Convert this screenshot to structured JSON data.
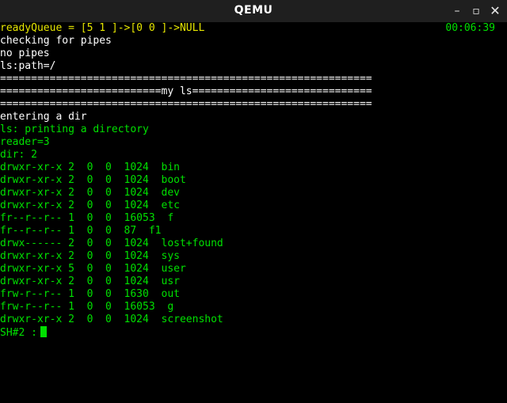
{
  "window": {
    "title": "QEMU",
    "controls": {
      "minimize": "–",
      "maximize": "▫",
      "close": "✕"
    }
  },
  "colors": {
    "green": "#00e000",
    "yellow": "#e6e600",
    "white": "#ffffff",
    "background": "#000000"
  },
  "terminal": {
    "clock": "00:06:39",
    "lines": [
      {
        "text": "readyQueue = [5 1 ]->[0 0 ]->NULL",
        "color": "yellow"
      },
      {
        "text": "checking for pipes",
        "color": "white"
      },
      {
        "text": "no pipes",
        "color": "white"
      },
      {
        "text": "ls:path=/",
        "color": "white"
      },
      {
        "text": "============================================================",
        "color": "white"
      },
      {
        "text": "==========================my ls=============================",
        "color": "white"
      },
      {
        "text": "============================================================",
        "color": "white"
      },
      {
        "text": "entering a dir",
        "color": "white"
      },
      {
        "text": "ls: printing a directory",
        "color": "green"
      },
      {
        "text": "reader=3",
        "color": "green"
      },
      {
        "text": "dir: 2",
        "color": "green"
      },
      {
        "text": "drwxr-xr-x 2  0  0  1024  bin",
        "color": "green"
      },
      {
        "text": "drwxr-xr-x 2  0  0  1024  boot",
        "color": "green"
      },
      {
        "text": "drwxr-xr-x 2  0  0  1024  dev",
        "color": "green"
      },
      {
        "text": "drwxr-xr-x 2  0  0  1024  etc",
        "color": "green"
      },
      {
        "text": "fr--r--r-- 1  0  0  16053  f",
        "color": "green"
      },
      {
        "text": "fr--r--r-- 1  0  0  87  f1",
        "color": "green"
      },
      {
        "text": "drwx------ 2  0  0  1024  lost+found",
        "color": "green"
      },
      {
        "text": "drwxr-xr-x 2  0  0  1024  sys",
        "color": "green"
      },
      {
        "text": "drwxr-xr-x 5  0  0  1024  user",
        "color": "green"
      },
      {
        "text": "drwxr-xr-x 2  0  0  1024  usr",
        "color": "green"
      },
      {
        "text": "frw-r--r-- 1  0  0  1630  out",
        "color": "green"
      },
      {
        "text": "frw-r--r-- 1  0  0  16053  g",
        "color": "green"
      },
      {
        "text": "drwxr-xr-x 2  0  0  1024  screenshot",
        "color": "green"
      }
    ],
    "prompt": "SH#2 :"
  }
}
